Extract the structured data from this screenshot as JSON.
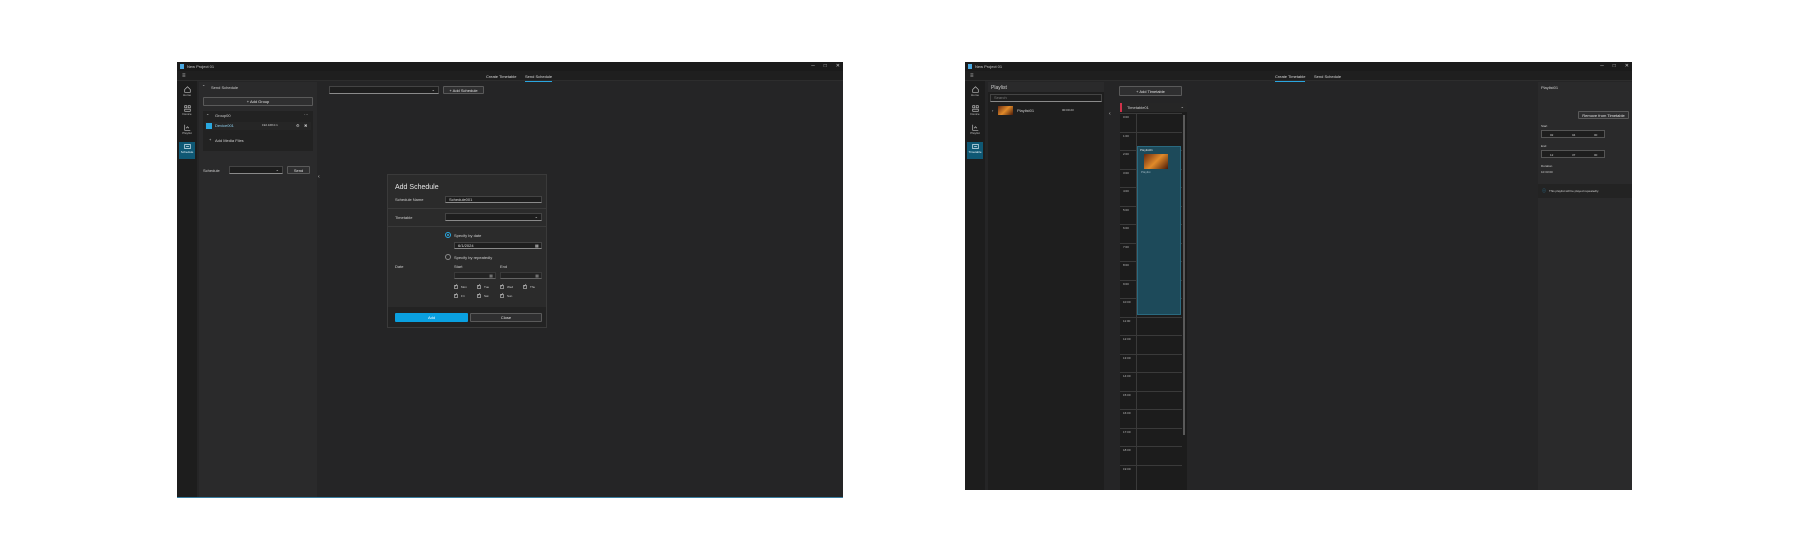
{
  "left_window": {
    "title": "New Project 01",
    "tabs": [
      "Create Timetable",
      "Send Schedule"
    ],
    "active_tab": 1,
    "rail": [
      {
        "label": "Home",
        "icon": "home-icon"
      },
      {
        "label": "Device",
        "icon": "device-icon"
      },
      {
        "label": "Playlist",
        "icon": "playlist-icon"
      },
      {
        "label": "Schedule",
        "icon": "schedule-icon"
      }
    ],
    "panel": {
      "header": "Send Schedule",
      "add_group": "Add Group",
      "group_name": "Group00",
      "device_name": "Device001",
      "device_ip": "192.168.0.1",
      "add_media": "Add Media Files",
      "schedule_label": "Schedule",
      "send_label": "Send"
    },
    "toolbar": {
      "add_schedule": "Add Schedule"
    },
    "modal": {
      "title": "Add Schedule",
      "name_label": "Schedule Name",
      "name_value": "Schedule001",
      "timetable_label": "Timetable",
      "date_label": "Date",
      "radio_date": "Specify by date",
      "date_value": "6/1/2024",
      "radio_repeat": "Specify by repeatedly",
      "start_label": "Start",
      "end_label": "End",
      "days": [
        "Mon",
        "Tue",
        "Wed",
        "Thu",
        "Fri",
        "Sat",
        "Sun"
      ],
      "add_button": "Add",
      "close_button": "Close"
    }
  },
  "right_window": {
    "title": "New Project 01",
    "tabs": [
      "Create Timetable",
      "Send Schedule"
    ],
    "active_tab": 0,
    "rail": [
      {
        "label": "Home",
        "icon": "home-icon"
      },
      {
        "label": "Device",
        "icon": "device-icon"
      },
      {
        "label": "Playlist",
        "icon": "playlist-icon"
      },
      {
        "label": "Timetable",
        "icon": "timetable-icon"
      }
    ],
    "playlist_panel": {
      "header": "Playlist",
      "search_placeholder": "Search",
      "item_name": "Playlist01",
      "item_duration": "00:00:23"
    },
    "add_timetable": "Add Timetable",
    "timetable_name": "Timetable01",
    "hours": [
      "0:00",
      "1:00",
      "2:00",
      "3:00",
      "4:00",
      "5:00",
      "6:00",
      "7:00",
      "8:00",
      "9:00",
      "10:00",
      "11:00",
      "12:00",
      "13:00",
      "14:00",
      "15:00",
      "16:00",
      "17:00",
      "18:00",
      "19:00"
    ],
    "block": {
      "label": "Playlist01",
      "sub": "Playlist"
    },
    "props": {
      "header": "Playlist01",
      "remove_button": "Remove from Timetable",
      "start_label": "Start",
      "start": [
        "02",
        "04",
        "00"
      ],
      "end_label": "End",
      "end": [
        "12",
        "37",
        "00"
      ],
      "duration_label": "Duration",
      "duration": "10:33:00",
      "info": "This playlist will be played repeatedly."
    }
  },
  "colors": {
    "accent": "#29a8e0",
    "bg": "#252526",
    "selection": "#0f5874",
    "block": "#1d4a5a"
  }
}
